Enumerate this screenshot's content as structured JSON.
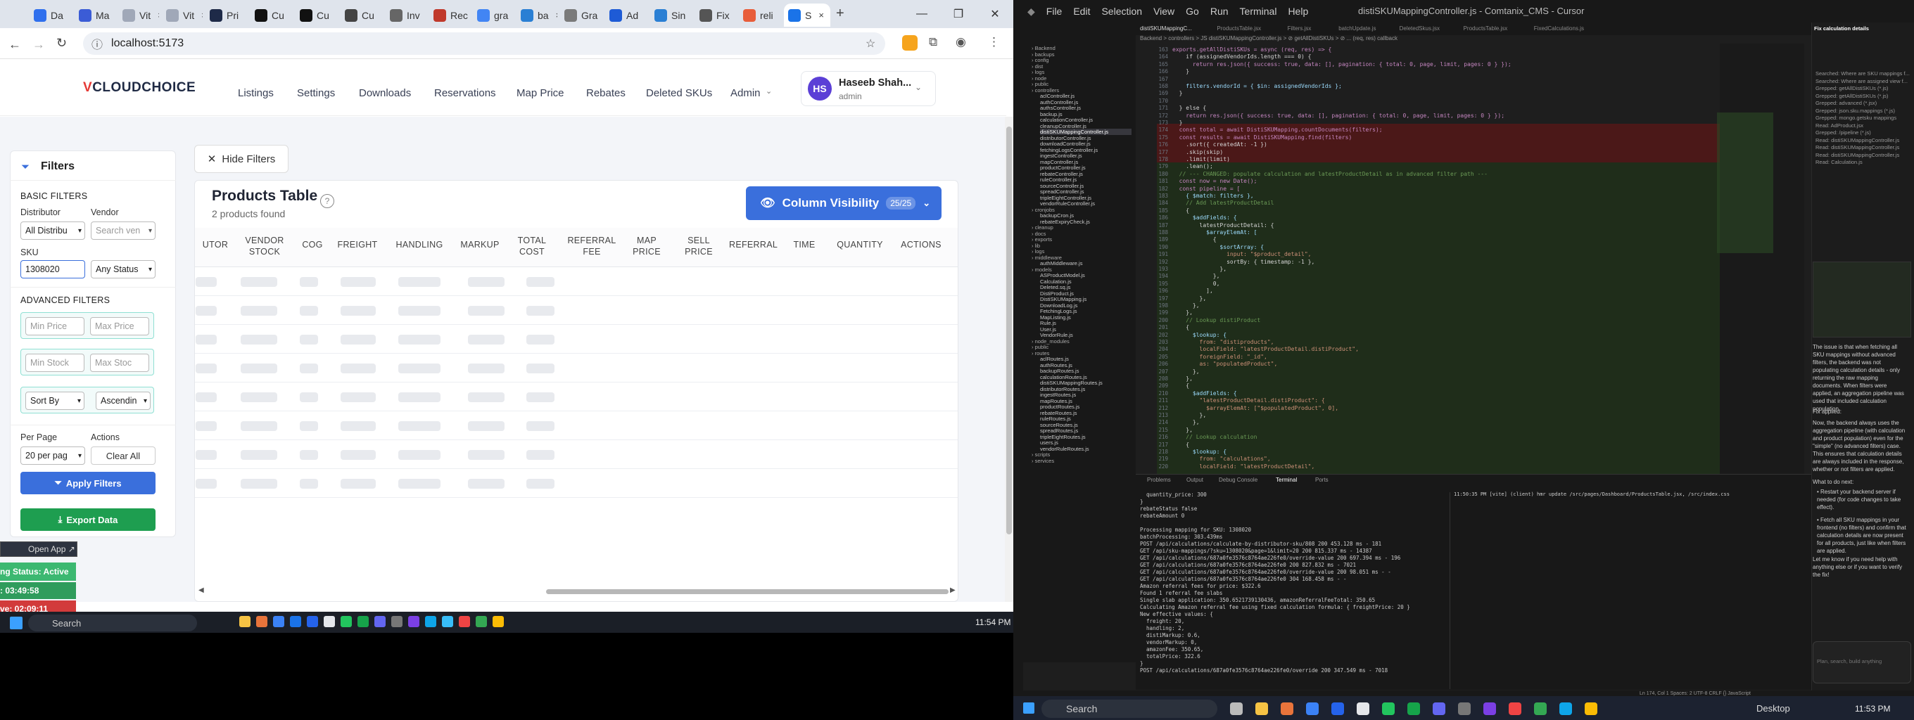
{
  "browser": {
    "tabs": [
      {
        "label": "Da",
        "color": "#2f6fed"
      },
      {
        "label": "Ma",
        "color": "#3b5cd6"
      },
      {
        "label": "Vit",
        "color": "#a0a8b8"
      },
      {
        "label": "Vit",
        "color": "#a0a8b8"
      },
      {
        "label": "Pri",
        "color": "#1e2a48"
      },
      {
        "label": "Cu",
        "color": "#111111"
      },
      {
        "label": "Cu",
        "color": "#111111"
      },
      {
        "label": "Cu",
        "color": "#444444"
      },
      {
        "label": "Inv",
        "color": "#666666"
      },
      {
        "label": "Rec",
        "color": "#c0392b"
      },
      {
        "label": "gra",
        "color": "#4285f4"
      },
      {
        "label": "ba",
        "color": "#2a7fd4"
      },
      {
        "label": "Gra",
        "color": "#7a7a7a"
      },
      {
        "label": "Ad",
        "color": "#1e5bd6"
      },
      {
        "label": "Sin",
        "color": "#2a7fd4"
      },
      {
        "label": "Fix",
        "color": "#555555"
      },
      {
        "label": "reli",
        "color": "#e85d3a"
      },
      {
        "label": "S",
        "color": "#1a73e8",
        "active": true
      }
    ],
    "url": "localhost:5173"
  },
  "app": {
    "logo": "VCLOUDCHOICE",
    "nav": [
      "Listings",
      "Settings",
      "Downloads",
      "Reservations",
      "Map Price",
      "Rebates",
      "Deleted SKUs",
      "Admin"
    ],
    "user": {
      "initials": "HS",
      "name": "Haseeb Shah...",
      "role": "admin"
    },
    "filters": {
      "title": "Filters",
      "basic_heading": "BASIC FILTERS",
      "distributor_label": "Distributor",
      "distributor_value": "All Distribu",
      "vendor_label": "Vendor",
      "vendor_placeholder": "Search ven",
      "sku_label": "SKU",
      "sku_value": "1308020",
      "status_value": "Any Status",
      "advanced_heading": "ADVANCED FILTERS",
      "min_price": "Min Price",
      "max_price": "Max Price",
      "min_stock": "Min Stock",
      "max_stock": "Max Stoc",
      "sort_by": "Sort By",
      "sort_order": "Ascendin",
      "per_page_label": "Per Page",
      "per_page_value": "20 per pag",
      "actions_label": "Actions",
      "clear_all": "Clear All",
      "apply": "Apply Filters",
      "export": "Export Data"
    },
    "hide_filters": "Hide Filters",
    "table": {
      "title": "Products Table",
      "subtitle": "2 products found",
      "column_visibility": "Column Visibility",
      "column_count": "25/25",
      "headers": [
        "UTOR",
        "VENDOR STOCK",
        "COG",
        "FREIGHT",
        "HANDLING",
        "MARKUP",
        "TOTAL COST",
        "REFERRAL FEE",
        "MAP PRICE",
        "SELL PRICE",
        "REFERRAL",
        "TIME",
        "QUANTITY",
        "ACTIONS"
      ]
    },
    "widget": {
      "open_app": "Open App ↗",
      "status": "ng Status: Active",
      "timer1": ": 03:49:58",
      "timer2": "ve: 02:09:11"
    }
  },
  "taskbar_left": {
    "search": "Search",
    "time": "11:54 PM"
  },
  "ide": {
    "menu": [
      "File",
      "Edit",
      "Selection",
      "View",
      "Go",
      "Run",
      "Terminal",
      "Help"
    ],
    "title": "distiSKUMappingController.js - Comtanix_CMS - Cursor",
    "tabs": [
      "distiSKUMappingC...",
      "ProductsTable.jsx",
      "Filters.jsx",
      "batchUpdate.js",
      "DeletedSkus.jsx",
      "ProductsTable.jsx",
      "FixedCalculations.js"
    ],
    "breadcrumb": "Backend > controllers > JS distiSKUMappingController.js > ⊘ getAllDistiSKUs > ⊘ ... (req, res) callback",
    "explorer": [
      "Backend",
      "backups",
      "config",
      "dist",
      "logs",
      "node",
      "public",
      "controllers",
      "aclController.js",
      "authController.js",
      "authsController.js",
      "backup.js",
      "calculationController.js",
      "cleanupController.js",
      "distiSKUMappingController.js",
      "distributorController.js",
      "downloadController.js",
      "fetchingLogsController.js",
      "ingestController.js",
      "mapController.js",
      "productController.js",
      "rebateController.js",
      "ruleController.js",
      "sourceController.js",
      "spreadController.js",
      "tripleEightController.js",
      "vendorRuleController.js",
      "cronjobs",
      "backupCron.js",
      "rebateExpiryCheck.js",
      "cleanup",
      "docs",
      "exports",
      "lib",
      "logs",
      "middleware",
      "authMiddleware.js",
      "models",
      "ASProductModel.js",
      "Calculation.js",
      "Deleted.sq.js",
      "DistiProduct.js",
      "DistiSKUMapping.js",
      "DownloadLog.js",
      "FetchingLogs.js",
      "MapListing.js",
      "Rule.js",
      "User.js",
      "VendorRule.js",
      "node_modules",
      "public",
      "routes",
      "aclRoutes.js",
      "authRoutes.js",
      "backupRoutes.js",
      "calculationRoutes.js",
      "distiSKUMappingRoutes.js",
      "distributorRoutes.js",
      "ingestRoutes.js",
      "mapRoutes.js",
      "productRoutes.js",
      "rebateRoutes.js",
      "ruleRoutes.js",
      "sourceRoutes.js",
      "spreadRoutes.js",
      "tripleEightRoutes.js",
      "users.js",
      "vendorRuleRoutes.js",
      "scripts",
      "services"
    ],
    "code": [
      "exports.getAllDistiSKUs = async (req, res) => {",
      "    if (assignedVendorIds.length === 0) {",
      "      return res.json({ success: true, data: [], pagination: { total: 0, page, limit, pages: 0 } });",
      "    }",
      "",
      "    filters.vendorId = { $in: assignedVendorIds };",
      "  }",
      "",
      "  } else {",
      "    return res.json({ success: true, data: [], pagination: { total: 0, page, limit, pages: 0 } });",
      "  }",
      "  const total = await DistiSKUMapping.countDocuments(filters);",
      "  const results = await DistiSKUMapping.find(filters)",
      "    .sort({ createdAt: -1 })",
      "    .skip(skip)",
      "    .limit(limit)",
      "    .lean();",
      "  // --- CHANGED: populate calculation and latestProductDetail as in advanced filter path ---",
      "  const now = new Date();",
      "  const pipeline = [",
      "    { $match: filters },",
      "    // Add latestProductDetail",
      "    {",
      "      $addFields: {",
      "        latestProductDetail: {",
      "          $arrayElemAt: [",
      "            {",
      "              $sortArray: {",
      "                input: \"$product_detail\",",
      "                sortBy: { timestamp: -1 },",
      "              },",
      "            },",
      "            0,",
      "          ],",
      "        },",
      "      },",
      "    },",
      "    // Lookup distiProduct",
      "    {",
      "      $lookup: {",
      "        from: \"distiproducts\",",
      "        localField: \"latestProductDetail.distiProduct\",",
      "        foreignField: \"_id\",",
      "        as: \"populatedProduct\",",
      "      },",
      "    },",
      "    {",
      "      $addFields: {",
      "        \"latestProductDetail.distiProduct\": {",
      "          $arrayElemAt: [\"$populatedProduct\", 0],",
      "        },",
      "      },",
      "    },",
      "    // Lookup calculation",
      "    {",
      "      $lookup: {",
      "        from: \"calculations\",",
      "        localField: \"latestProductDetail\","
    ],
    "panel_tabs": [
      "Problems",
      "Output",
      "Debug Console",
      "Terminal",
      "Ports"
    ],
    "terminal_left": [
      "  quantity_price: 300",
      "}",
      "rebateStatus false",
      "rebateAmount 0",
      "",
      "Processing mapping for SKU: 1308020",
      "batchProcessing: 303.439ms",
      "POST /api/calculations/calculate-by-distributor-sku/808 200 453.128 ms - 181",
      "GET /api/sku-mappings/?sku=1308020&page=1&limit=20 200 815.337 ms - 14387",
      "GET /api/calculations/687a0fe3576c8764ae226fe0/override-value 200 697.394 ms - 196",
      "GET /api/calculations/687a0fe3576c8764ae226fe0 200 827.832 ms - 7021",
      "GET /api/calculations/687a0fe3576c8764ae226fe0/override-value 200 98.051 ms - -",
      "GET /api/calculations/687a0fe3576c8764ae226fe0 304 168.458 ms - -",
      "Amazon referral fees for price: $322.6",
      "Found 1 referral fee slabs",
      "Single slab application: 350.6521739130436, amazonReferralFeeTotal: 350.65",
      "Calculating Amazon referral fee using fixed calculation formula: { freightPrice: 20 }",
      "New effective values: {",
      "  freight: 20,",
      "  handling: 2,",
      "  distiMarkup: 0.6,",
      "  vendorMarkup: 0,",
      "  amazonFee: 350.65,",
      "  totalPrice: 322.6",
      "}",
      "POST /api/calculations/687a0fe3576c8764ae226fe0/override 200 347.549 ms - 7018"
    ],
    "terminal_right": "11:50:35 PM [vite] (client) hmr update /src/pages/Dashboard/ProductsTable.jsx, /src/index.css",
    "chat": [
      "Fix calculation details",
      "Searched: Where are SKU mappings f...",
      "Searched: Where are assigned view f...",
      "Grepped: getAllDistiSKUs (*.js)",
      "Grepped: getAllDistiSKUs (*.js)",
      "Grepped: advanced (*.jsx)",
      "Grepped: json.sku.mappings (*.js)",
      "Grepped: mongo.getsku mappings",
      "Read: AdProduct.jsx",
      "Grepped: /pipeline (*.js)",
      "Read: distiSKUMappingController.js",
      "Read: distiSKUMappingController.js",
      "Read: distiSKUMappingController.js",
      "Read: Calculation.js"
    ],
    "chat_para1": "The issue is that when fetching all SKU mappings without advanced filters, the backend was not populating calculation details - only returning the raw mapping documents. When filters were applied, an aggregation pipeline was used that included calculation population.",
    "chat_para2": "Fix applied:",
    "chat_para3": "Now, the backend always uses the aggregation pipeline (with calculation and product population) even for the \"simple\" (no advanced filters) case. This ensures that calculation details are always included in the response, whether or not filters are applied.",
    "chat_para4": "What to do next:",
    "chat_bullets": [
      "Restart your backend server if needed (for code changes to take effect).",
      "Fetch all SKU mappings in your frontend (no filters) and confirm that calculation details are now present for all products, just like when filters are applied."
    ],
    "chat_para5": "Let me know if you need help with anything else or if you want to verify the fix!",
    "chat_input": "Plan, search, build anything",
    "status": "Ln 174, Col 1   Spaces: 2   UTF-8   CRLF   {} JavaScript",
    "time": "11:53 PM",
    "search": "Search",
    "desktop": "Desktop"
  }
}
